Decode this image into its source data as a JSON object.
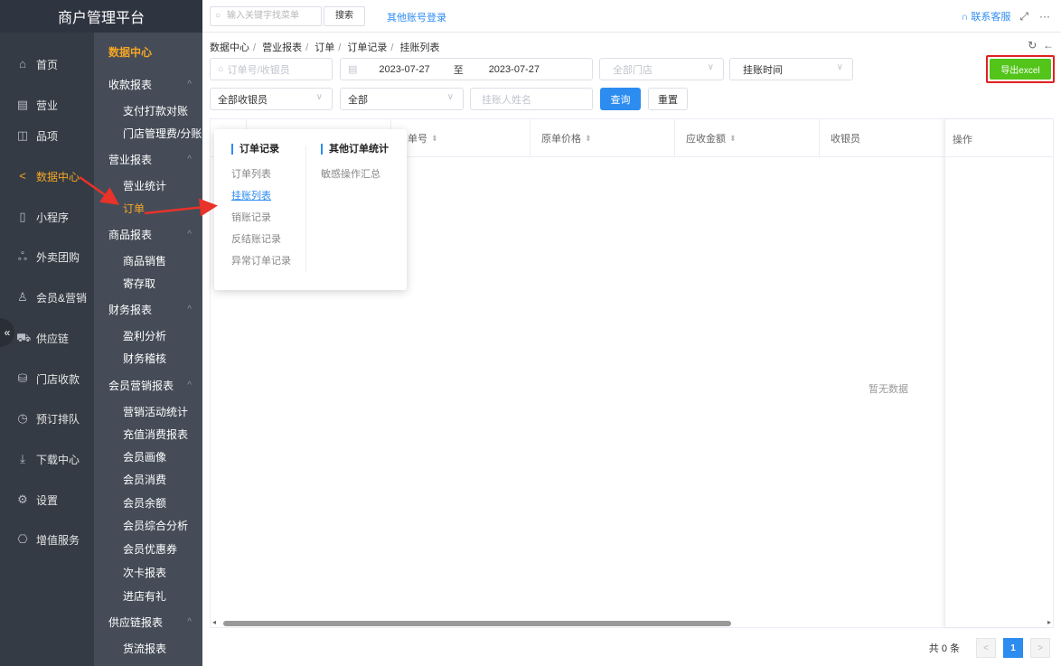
{
  "app": {
    "title": "商户管理平台"
  },
  "topbar": {
    "search_placeholder": "输入关键字找菜单",
    "search_button": "搜索",
    "other_login": "其他账号登录",
    "service": "联系客服"
  },
  "nav1": [
    {
      "label": "首页",
      "icon": "home-icon"
    },
    {
      "label": "营业",
      "icon": "calendar-icon"
    },
    {
      "label": "品项",
      "icon": "bag-icon"
    },
    {
      "label": "数据中心",
      "icon": "share-icon",
      "active": true
    },
    {
      "label": "小程序",
      "icon": "phone-icon"
    },
    {
      "label": "外卖团购",
      "icon": "group-icon"
    },
    {
      "label": "会员&营销",
      "icon": "user-icon"
    },
    {
      "label": "供应链",
      "icon": "truck-icon"
    },
    {
      "label": "门店收款",
      "icon": "database-icon"
    },
    {
      "label": "预订排队",
      "icon": "clock-icon"
    },
    {
      "label": "下载中心",
      "icon": "download-icon"
    },
    {
      "label": "设置",
      "icon": "gear-icon"
    },
    {
      "label": "增值服务",
      "icon": "gift-icon"
    }
  ],
  "nav2": {
    "header": "数据中心",
    "groups": [
      {
        "label": "收款报表",
        "items": [
          "支付打款对账",
          "门店管理费/分账"
        ]
      },
      {
        "label": "营业报表",
        "items": [
          "营业统计",
          "订单"
        ]
      },
      {
        "label": "商品报表",
        "items": [
          "商品销售",
          "寄存取"
        ]
      },
      {
        "label": "财务报表",
        "items": [
          "盈利分析",
          "财务稽核"
        ]
      },
      {
        "label": "会员营销报表",
        "items": [
          "营销活动统计",
          "充值消费报表",
          "会员画像",
          "会员消费",
          "会员余额",
          "会员综合分析",
          "会员优惠券",
          "次卡报表",
          "进店有礼"
        ]
      },
      {
        "label": "供应链报表",
        "items": [
          "货流报表"
        ]
      }
    ]
  },
  "breadcrumb": [
    "数据中心",
    "营业报表",
    "订单",
    "订单记录",
    "挂账列表"
  ],
  "filters": {
    "order_placeholder": "订单号/收银员",
    "date_start": "2023-07-27",
    "date_sep": "至",
    "date_end": "2023-07-27",
    "store_placeholder": "全部门店",
    "time_type": "挂账时间",
    "cashier": "全部收银员",
    "status": "全部",
    "person_placeholder": "挂账人姓名",
    "query": "查询",
    "reset": "重置",
    "export": "导出excel"
  },
  "table": {
    "headers": [
      "单号",
      "原单价格",
      "应收金额",
      "收银员"
    ],
    "op_header": "操作",
    "empty": "暂无数据"
  },
  "pager": {
    "total": "共 0 条",
    "current": "1"
  },
  "popup": {
    "col1": {
      "title": "订单记录",
      "items": [
        "订单列表",
        "挂账列表",
        "销账记录",
        "反结账记录",
        "异常订单记录"
      ]
    },
    "col2": {
      "title": "其他订单统计",
      "items": [
        "敏感操作汇总"
      ]
    }
  }
}
